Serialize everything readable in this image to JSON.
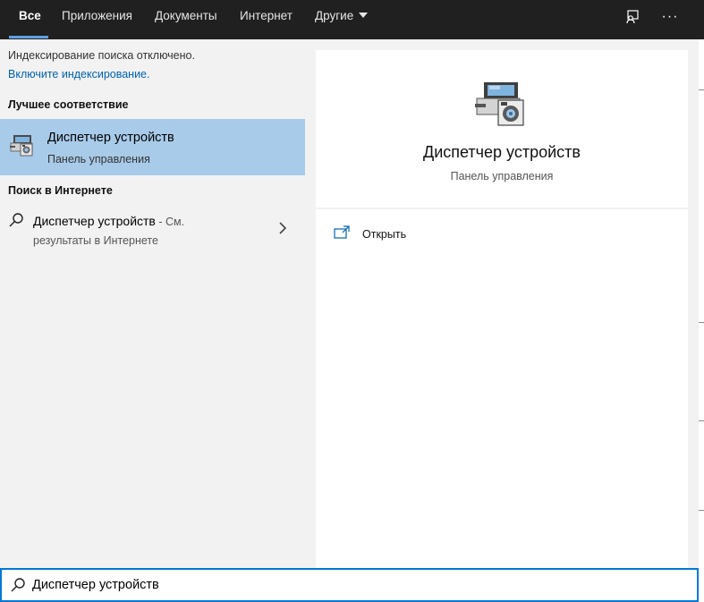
{
  "tabs": [
    {
      "label": "Все",
      "active": true
    },
    {
      "label": "Приложения"
    },
    {
      "label": "Документы"
    },
    {
      "label": "Интернет"
    },
    {
      "label": "Другие"
    }
  ],
  "top_icons": [
    "feedback-icon",
    "more-options-icon"
  ],
  "top_more_label": "···",
  "indexing": {
    "message": "Индексирование поиска отключено.",
    "link": "Включите индексирование."
  },
  "best_match": {
    "header": "Лучшее соответствие",
    "title": "Диспетчер устройств",
    "subtitle": "Панель управления",
    "icon": "device-manager-icon"
  },
  "web_search": {
    "header": "Поиск в Интернете",
    "title": "Диспетчер устройств",
    "suffix": " - См.",
    "line2": "результаты в Интернете"
  },
  "details": {
    "title": "Диспетчер устройств",
    "subtitle": "Панель управления",
    "icon": "device-manager-icon"
  },
  "actions": [
    {
      "label": "Открыть",
      "icon": "open-icon"
    }
  ],
  "search": {
    "value": "Диспетчер устройств"
  },
  "colors": {
    "topbar": "#202020",
    "accent": "#0078d7",
    "selected": "#a8cbe9",
    "link": "#0063b1",
    "panel": "#f2f2f2"
  }
}
